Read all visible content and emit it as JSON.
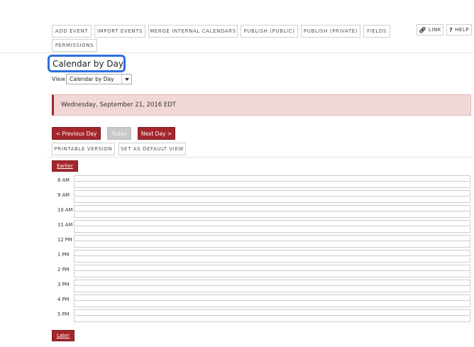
{
  "toolbar": {
    "buttons": [
      "Add Event",
      "Import Events",
      "Merge Internal Calendars",
      "Publish (Public)",
      "Publish (Private)",
      "Fields",
      "Permissions"
    ],
    "link_label": "LINK",
    "help_label": "HELP"
  },
  "page_title": "Calendar by Day",
  "view": {
    "label": "View",
    "selected": "Calendar by Day"
  },
  "date_banner": "Wednesday, September 21, 2016 EDT",
  "nav": {
    "previous": "< Previous Day",
    "today": "Today",
    "next": "Next Day >"
  },
  "secondary": {
    "printable": "Printable Version",
    "default_view": "Set as Default View"
  },
  "earlier_label": "Earlier",
  "later_label": "Later",
  "hours": [
    "8 AM",
    "9 AM",
    "10 AM",
    "11 AM",
    "12 PM",
    "1 PM",
    "2 PM",
    "3 PM",
    "4 PM",
    "5 PM"
  ],
  "colors": {
    "accent_red": "#a4262c",
    "banner_bg": "#f2d7d7",
    "highlight_blue": "#2f6fe0"
  }
}
